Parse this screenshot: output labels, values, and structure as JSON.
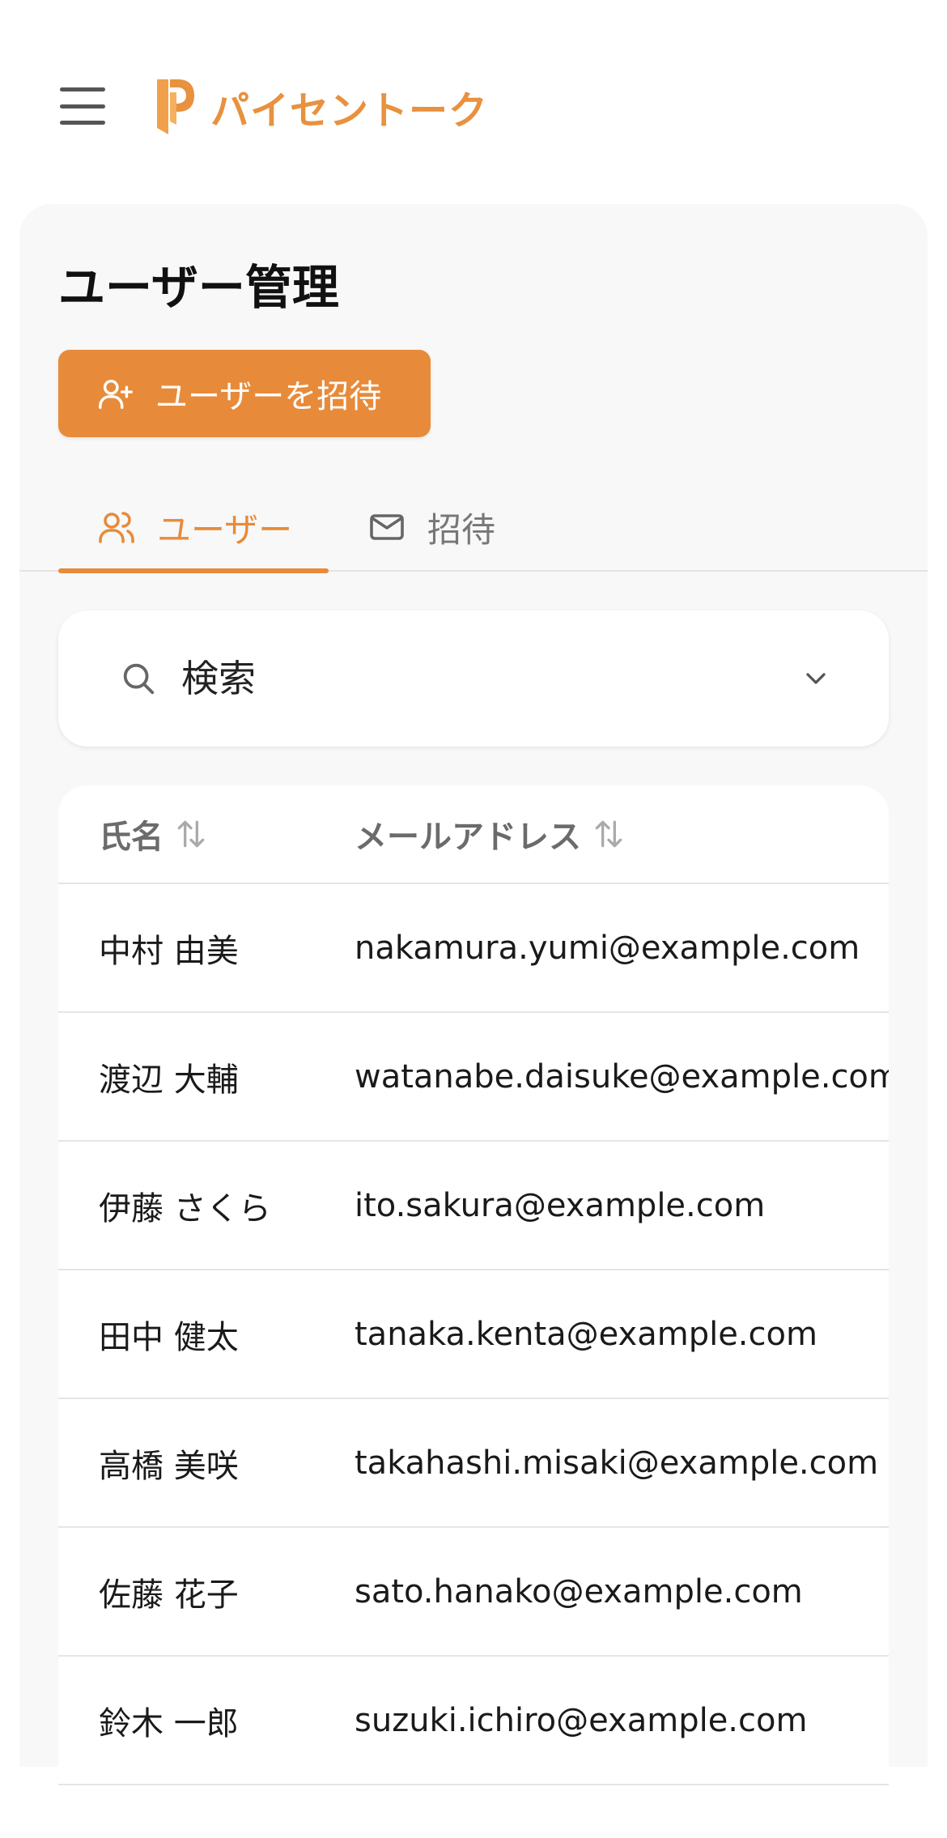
{
  "header": {
    "brand_name": "パイセントーク",
    "brand_color": "#e8913e"
  },
  "page": {
    "title": "ユーザー管理",
    "invite_button_label": "ユーザーを招待"
  },
  "tabs": [
    {
      "label": "ユーザー",
      "icon": "users-icon",
      "active": true
    },
    {
      "label": "招待",
      "icon": "mail-icon",
      "active": false
    }
  ],
  "search": {
    "placeholder": "検索"
  },
  "table": {
    "columns": [
      {
        "label": "氏名"
      },
      {
        "label": "メールアドレス"
      }
    ],
    "rows": [
      {
        "name": "中村 由美",
        "email": "nakamura.yumi@example.com"
      },
      {
        "name": "渡辺 大輔",
        "email": "watanabe.daisuke@example.com"
      },
      {
        "name": "伊藤 さくら",
        "email": "ito.sakura@example.com"
      },
      {
        "name": "田中 健太",
        "email": "tanaka.kenta@example.com"
      },
      {
        "name": "高橋 美咲",
        "email": "takahashi.misaki@example.com"
      },
      {
        "name": "佐藤 花子",
        "email": "sato.hanako@example.com"
      },
      {
        "name": "鈴木 一郎",
        "email": "suzuki.ichiro@example.com"
      }
    ]
  },
  "colors": {
    "accent": "#e78b3a",
    "card_background": "#f8f8f8"
  }
}
